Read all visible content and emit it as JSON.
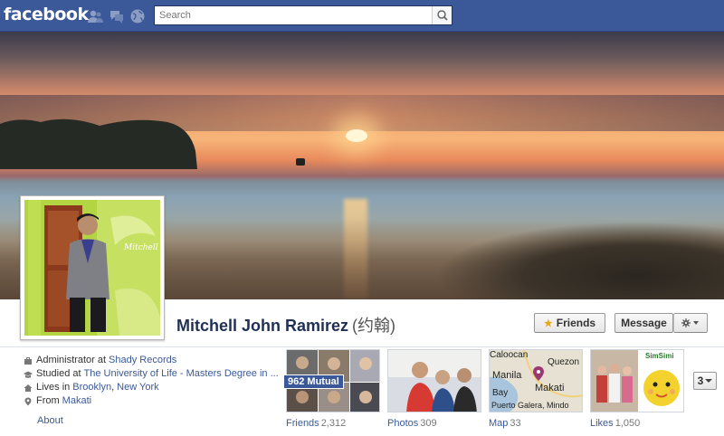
{
  "topbar": {
    "logo": "facebook",
    "search_placeholder": "Search",
    "icons": [
      "friend-requests-icon",
      "messages-icon",
      "notifications-globe-icon",
      "search-magnifier-icon"
    ]
  },
  "profile": {
    "name": "Mitchell John Ramirez",
    "alt_name": "(约翰)",
    "avatar_caption": "Mitchell Ramirez",
    "friends_button": "Friends",
    "message_button": "Message"
  },
  "info": [
    {
      "icon": "briefcase-icon",
      "prefix": "Administrator at",
      "link": "Shady Records"
    },
    {
      "icon": "graduation-cap-icon",
      "prefix": "Studied at",
      "link": "The University of Life - Masters Degree in ..."
    },
    {
      "icon": "home-icon",
      "prefix": "Lives in",
      "link": "Brooklyn",
      "sep": ",",
      "link2": "New York"
    },
    {
      "icon": "location-pin-icon",
      "prefix": "From",
      "link": "Makati"
    }
  ],
  "about_link": "About",
  "tiles": {
    "friends": {
      "label": "Friends",
      "count": "2,312",
      "badge": "962 Mutual"
    },
    "photos": {
      "label": "Photos",
      "count": "309"
    },
    "map": {
      "label": "Map",
      "count": "33",
      "places": [
        "Caloocan",
        "Quezon Cit",
        "Manila",
        "Makati",
        "Bay",
        "Puerto Galera, Mindo"
      ]
    },
    "likes": {
      "label": "Likes",
      "count": "1,050",
      "sticker": "SimSimi"
    }
  },
  "more_button": "3",
  "colors": {
    "brand": "#3b5998",
    "brand_dark": "#2d4486",
    "link": "#3b5998",
    "name": "#1f2f55"
  }
}
